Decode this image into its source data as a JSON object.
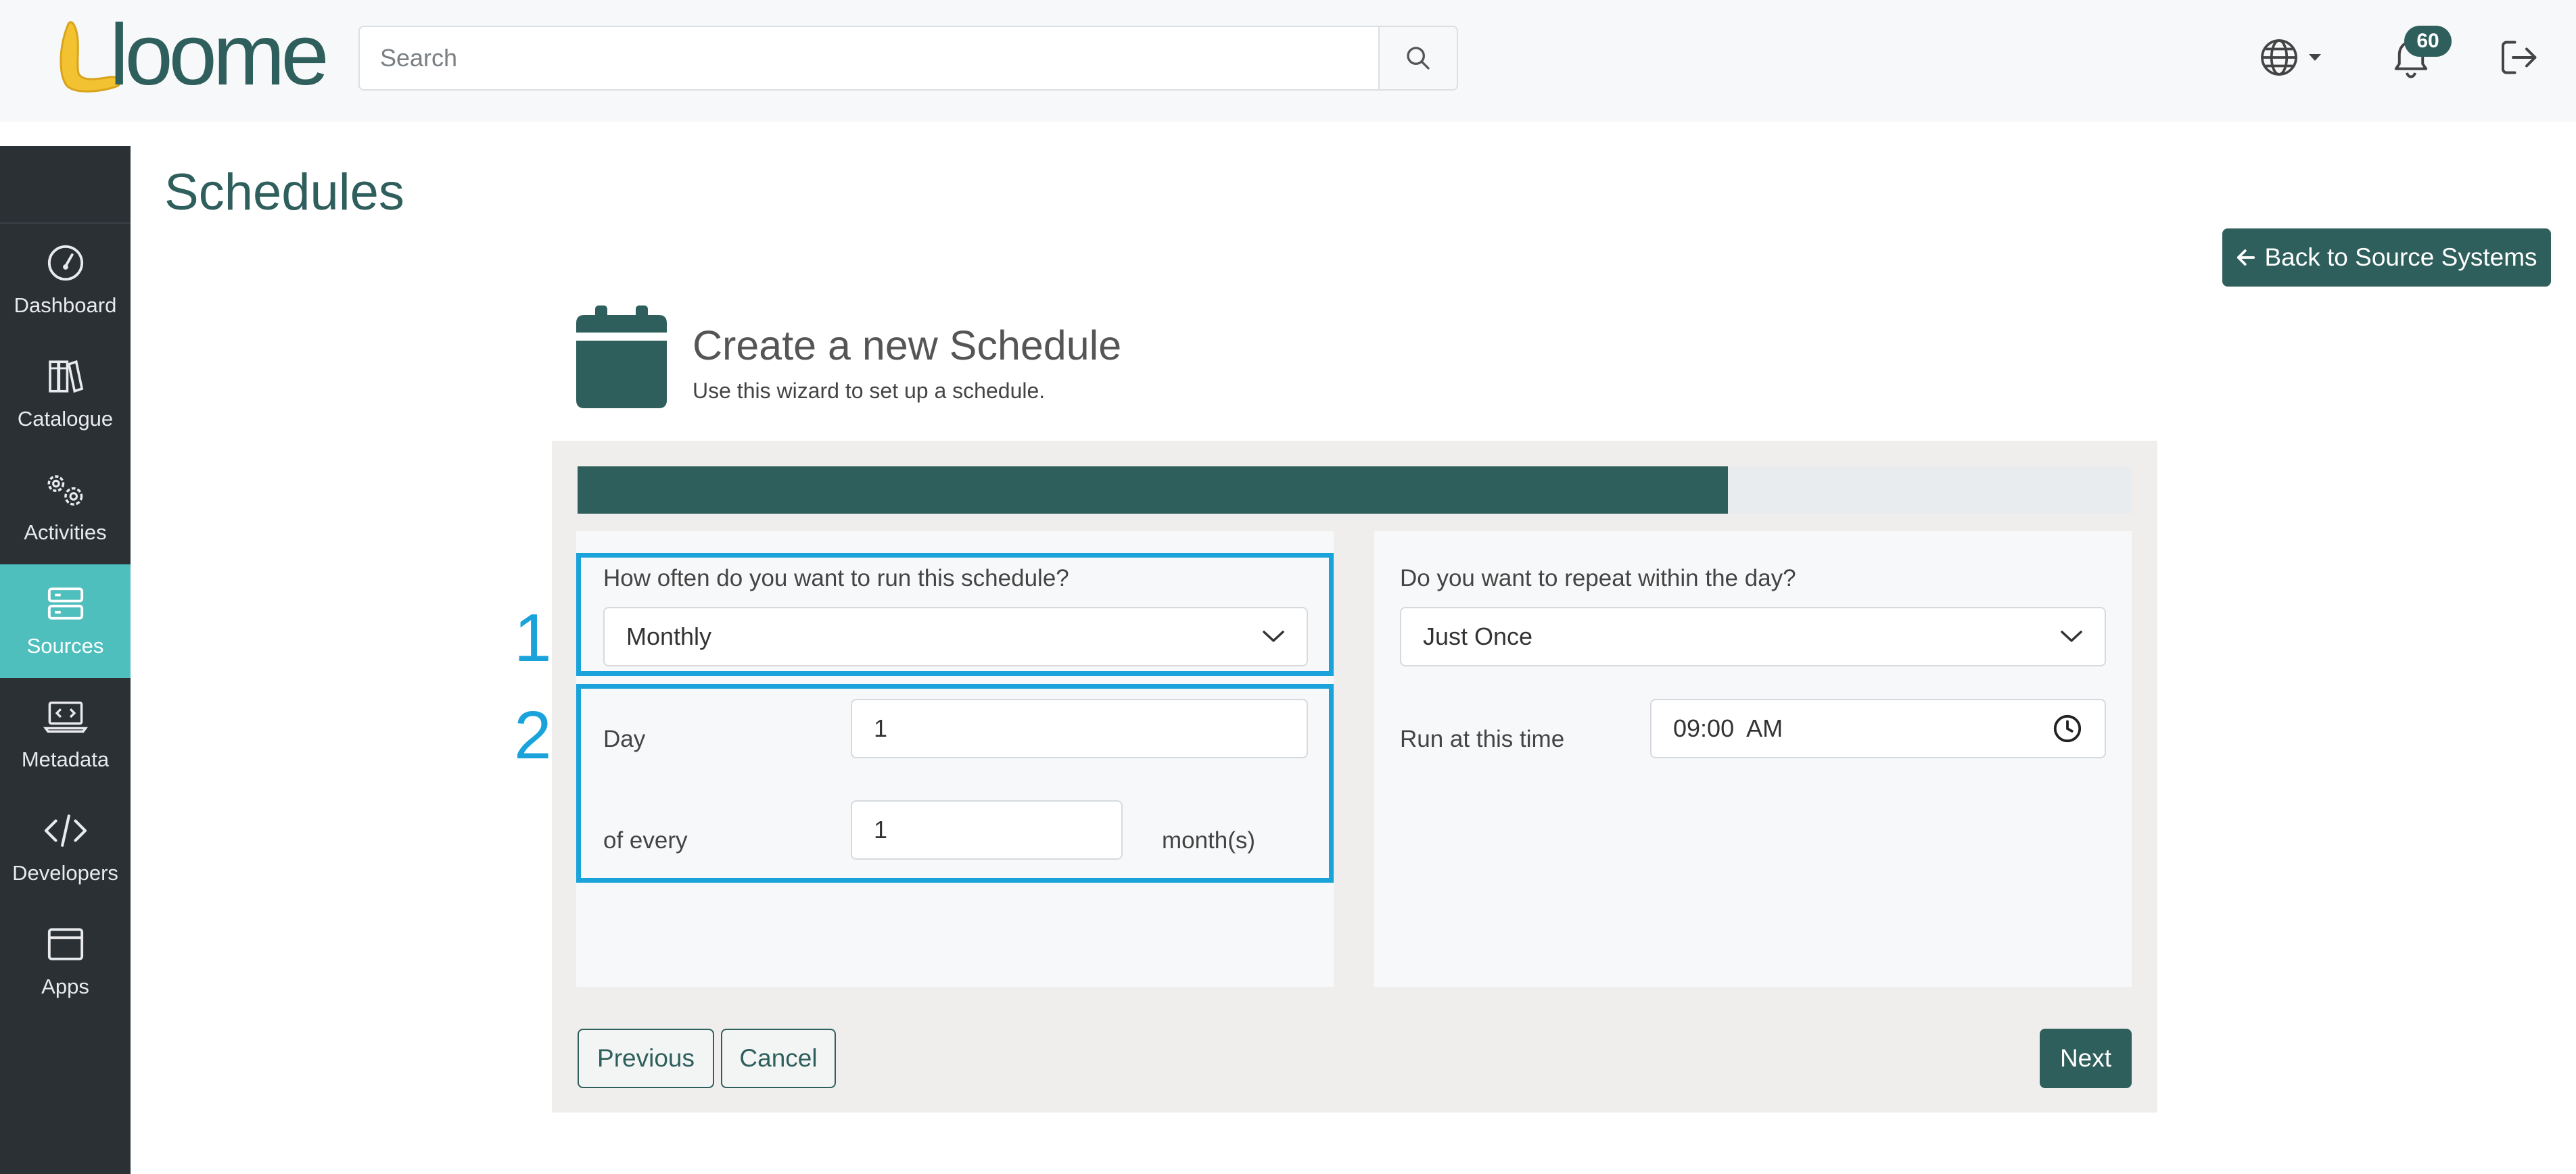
{
  "header": {
    "logo_text": "loome",
    "search_placeholder": "Search",
    "notification_count": "60"
  },
  "sidebar": {
    "items": [
      {
        "label": "Dashboard",
        "icon": "gauge-icon"
      },
      {
        "label": "Catalogue",
        "icon": "books-icon"
      },
      {
        "label": "Activities",
        "icon": "gears-icon"
      },
      {
        "label": "Sources",
        "icon": "server-icon",
        "active": true
      },
      {
        "label": "Metadata",
        "icon": "laptop-code-icon"
      },
      {
        "label": "Developers",
        "icon": "code-icon"
      },
      {
        "label": "Apps",
        "icon": "window-icon"
      }
    ]
  },
  "page": {
    "title": "Schedules",
    "back_button": "Back to Source Systems"
  },
  "wizard": {
    "title": "Create a new Schedule",
    "subtitle": "Use this wizard to set up a schedule.",
    "progress_fraction": 0.74,
    "frequency_label": "How often do you want to run this schedule?",
    "frequency_value": "Monthly",
    "day_label": "Day",
    "day_value": "1",
    "every_label": "of every",
    "every_value": "1",
    "every_unit": "month(s)",
    "repeat_label": "Do you want to repeat within the day?",
    "repeat_value": "Just Once",
    "time_label": "Run at this time",
    "time_value": "09:00  AM",
    "annotation_1": "1",
    "annotation_2": "2",
    "previous_button": "Previous",
    "cancel_button": "Cancel",
    "next_button": "Next"
  },
  "colors": {
    "brand": "#2f5f5c",
    "active_nav": "#4fbfbd",
    "highlight": "#1aa3db",
    "sidebar_bg": "#2b3035",
    "logo_accent": "#f2c230"
  }
}
